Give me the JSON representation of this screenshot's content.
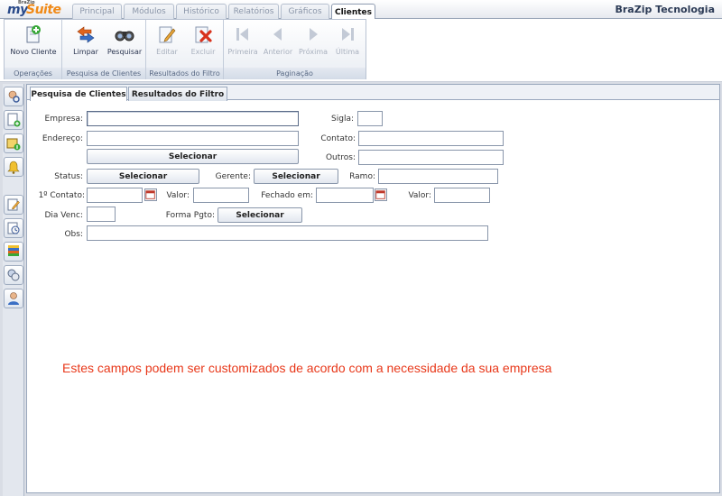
{
  "app": {
    "brand_small": "BraZip",
    "brand_my": "my",
    "brand_suite": "Suite",
    "company": "BraZip Tecnologia"
  },
  "tabs": [
    {
      "label": "Principal"
    },
    {
      "label": "Módulos"
    },
    {
      "label": "Histórico"
    },
    {
      "label": "Relatórios"
    },
    {
      "label": "Gráficos"
    },
    {
      "label": "Clientes"
    }
  ],
  "ribbon": {
    "operacoes": {
      "label": "Operações",
      "novo_cliente": "Novo Cliente"
    },
    "pesquisa": {
      "label": "Pesquisa de Clientes",
      "limpar": "Limpar",
      "pesquisar": "Pesquisar"
    },
    "resultados": {
      "label": "Resultados do Filtro",
      "editar": "Editar",
      "excluir": "Excluir"
    },
    "paginacao": {
      "label": "Paginação",
      "primeira": "Primeira",
      "anterior": "Anterior",
      "proxima": "Próxima",
      "ultima": "Última"
    }
  },
  "inner_tabs": {
    "pesquisa": "Pesquisa de Clientes",
    "resultados": "Resultados do Filtro"
  },
  "form": {
    "empresa": "Empresa:",
    "sigla": "Sigla:",
    "endereco": "Endereço:",
    "contato": "Contato:",
    "outros": "Outros:",
    "status": "Status:",
    "gerente": "Gerente:",
    "ramo": "Ramo:",
    "primeiro_contato": "1º Contato:",
    "valor1": "Valor:",
    "fechado_em": "Fechado em:",
    "valor2": "Valor:",
    "dia_venc": "Dia Venc:",
    "forma_pgto": "Forma Pgto:",
    "obs": "Obs:",
    "selecionar": "Selecionar"
  },
  "note": "Estes campos podem ser customizados de acordo com a necessidade da sua empresa"
}
